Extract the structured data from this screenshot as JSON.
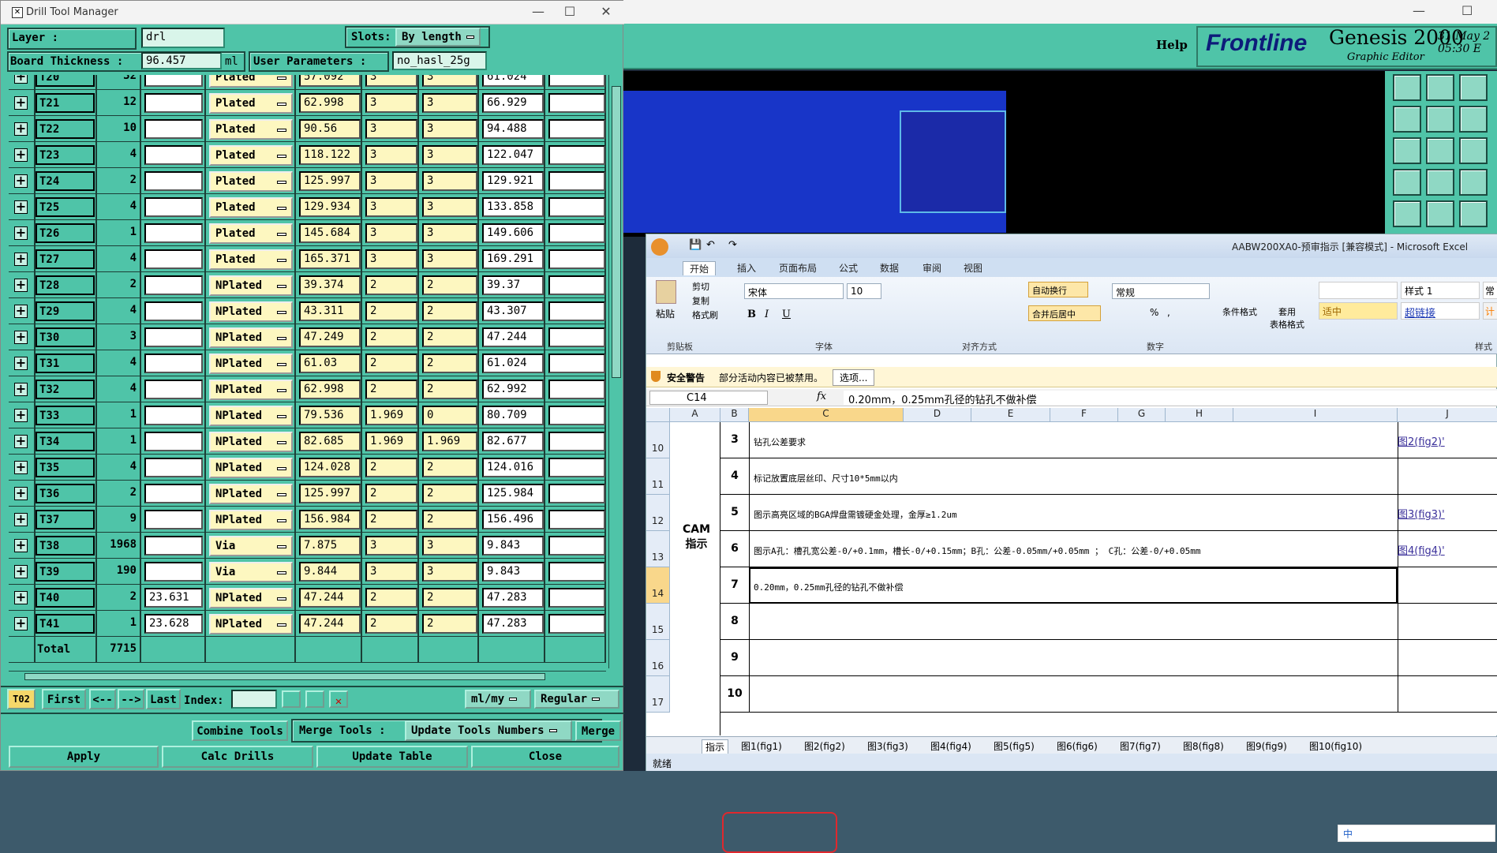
{
  "genesis": {
    "help_label": "Help",
    "logo_text": "Frontline",
    "product": "Genesis 2000",
    "subtitle": "Graphic Editor",
    "date": "31 May 2",
    "time": "05:30 E"
  },
  "dtm": {
    "title": "Drill Tool Manager",
    "layer_label": "Layer            :",
    "layer_value": "drl",
    "slots_label": "Slots:",
    "slots_value": "By length",
    "board_thickness_label": "Board Thickness :",
    "board_thickness_value": "96.457",
    "board_thickness_unit": "ml",
    "user_params_label": "User Parameters :",
    "user_params_value": "no_hasl_25g",
    "rows": [
      {
        "tool": "T20",
        "count": "32",
        "v1": "",
        "type": "Plated",
        "fin": "57.092",
        "tp": "3",
        "tm": "3",
        "drill": "61.024",
        "v2": ""
      },
      {
        "tool": "T21",
        "count": "12",
        "v1": "",
        "type": "Plated",
        "fin": "62.998",
        "tp": "3",
        "tm": "3",
        "drill": "66.929",
        "v2": ""
      },
      {
        "tool": "T22",
        "count": "10",
        "v1": "",
        "type": "Plated",
        "fin": "90.56",
        "tp": "3",
        "tm": "3",
        "drill": "94.488",
        "v2": ""
      },
      {
        "tool": "T23",
        "count": "4",
        "v1": "",
        "type": "Plated",
        "fin": "118.122",
        "tp": "3",
        "tm": "3",
        "drill": "122.047",
        "v2": ""
      },
      {
        "tool": "T24",
        "count": "2",
        "v1": "",
        "type": "Plated",
        "fin": "125.997",
        "tp": "3",
        "tm": "3",
        "drill": "129.921",
        "v2": ""
      },
      {
        "tool": "T25",
        "count": "4",
        "v1": "",
        "type": "Plated",
        "fin": "129.934",
        "tp": "3",
        "tm": "3",
        "drill": "133.858",
        "v2": ""
      },
      {
        "tool": "T26",
        "count": "1",
        "v1": "",
        "type": "Plated",
        "fin": "145.684",
        "tp": "3",
        "tm": "3",
        "drill": "149.606",
        "v2": ""
      },
      {
        "tool": "T27",
        "count": "4",
        "v1": "",
        "type": "Plated",
        "fin": "165.371",
        "tp": "3",
        "tm": "3",
        "drill": "169.291",
        "v2": ""
      },
      {
        "tool": "T28",
        "count": "2",
        "v1": "",
        "type": "NPlated",
        "fin": "39.374",
        "tp": "2",
        "tm": "2",
        "drill": "39.37",
        "v2": ""
      },
      {
        "tool": "T29",
        "count": "4",
        "v1": "",
        "type": "NPlated",
        "fin": "43.311",
        "tp": "2",
        "tm": "2",
        "drill": "43.307",
        "v2": ""
      },
      {
        "tool": "T30",
        "count": "3",
        "v1": "",
        "type": "NPlated",
        "fin": "47.249",
        "tp": "2",
        "tm": "2",
        "drill": "47.244",
        "v2": ""
      },
      {
        "tool": "T31",
        "count": "4",
        "v1": "",
        "type": "NPlated",
        "fin": "61.03",
        "tp": "2",
        "tm": "2",
        "drill": "61.024",
        "v2": ""
      },
      {
        "tool": "T32",
        "count": "4",
        "v1": "",
        "type": "NPlated",
        "fin": "62.998",
        "tp": "2",
        "tm": "2",
        "drill": "62.992",
        "v2": ""
      },
      {
        "tool": "T33",
        "count": "1",
        "v1": "",
        "type": "NPlated",
        "fin": "79.536",
        "tp": "1.969",
        "tm": "0",
        "drill": "80.709",
        "v2": ""
      },
      {
        "tool": "T34",
        "count": "1",
        "v1": "",
        "type": "NPlated",
        "fin": "82.685",
        "tp": "1.969",
        "tm": "1.969",
        "drill": "82.677",
        "v2": ""
      },
      {
        "tool": "T35",
        "count": "4",
        "v1": "",
        "type": "NPlated",
        "fin": "124.028",
        "tp": "2",
        "tm": "2",
        "drill": "124.016",
        "v2": ""
      },
      {
        "tool": "T36",
        "count": "2",
        "v1": "",
        "type": "NPlated",
        "fin": "125.997",
        "tp": "2",
        "tm": "2",
        "drill": "125.984",
        "v2": ""
      },
      {
        "tool": "T37",
        "count": "9",
        "v1": "",
        "type": "NPlated",
        "fin": "156.984",
        "tp": "2",
        "tm": "2",
        "drill": "156.496",
        "v2": ""
      },
      {
        "tool": "T38",
        "count": "1968",
        "v1": "",
        "type": "Via",
        "fin": "7.875",
        "tp": "3",
        "tm": "3",
        "drill": "9.843",
        "v2": ""
      },
      {
        "tool": "T39",
        "count": "190",
        "v1": "",
        "type": "Via",
        "fin": "9.844",
        "tp": "3",
        "tm": "3",
        "drill": "9.843",
        "v2": ""
      },
      {
        "tool": "T40",
        "count": "2",
        "v1": "23.631",
        "type": "NPlated",
        "fin": "47.244",
        "tp": "2",
        "tm": "2",
        "drill": "47.283",
        "v2": ""
      },
      {
        "tool": "T41",
        "count": "1",
        "v1": "23.628",
        "type": "NPlated",
        "fin": "47.244",
        "tp": "2",
        "tm": "2",
        "drill": "47.283",
        "v2": ""
      }
    ],
    "total_label": "Total",
    "total_value": "7715",
    "nav": {
      "current": "T02",
      "first": "First",
      "prev": "<--",
      "next": "-->",
      "last": "Last",
      "index_label": "Index:",
      "units": "ml/my",
      "mode": "Regular"
    },
    "combine_tools": "Combine Tools",
    "merge_tools_label": "Merge Tools :",
    "merge_tools_value": "Update Tools Numbers",
    "merge": "Merge",
    "apply": "Apply",
    "calc_drills": "Calc Drills",
    "update_table": "Update Table",
    "close": "Close"
  },
  "excel": {
    "title": "AABW200XA0-预审指示  [兼容模式] - Microsoft Excel",
    "tabs": [
      "开始",
      "插入",
      "页面布局",
      "公式",
      "数据",
      "审阅",
      "视图"
    ],
    "clipboard": {
      "paste": "粘贴",
      "cut": "剪切",
      "copy": "复制",
      "format_painter": "格式刷",
      "group": "剪贴板"
    },
    "font": {
      "name": "宋体",
      "size": "10",
      "bold": "B",
      "italic": "I",
      "underline": "U",
      "group": "字体"
    },
    "alignment": {
      "wrap": "自动换行",
      "merge": "合并后居中",
      "group": "对齐方式"
    },
    "number": {
      "format": "常规",
      "group": "数字",
      "percent": "%",
      "comma": ","
    },
    "styles": {
      "conditional": "条件格式",
      "table": "套用\n表格格式",
      "style1": "样式 1",
      "style_chang": "常",
      "moderate": "适中",
      "hyperlink": "超链接",
      "calc": "计",
      "group": "样式"
    },
    "security_label": "安全警告",
    "security_text": "部分活动内容已被禁用。",
    "options": "选项...",
    "name_box": "C14",
    "fx": "fx",
    "formula": "0.20mm，0.25mm孔径的钻孔不做补偿",
    "columns": [
      "A",
      "B",
      "C",
      "D",
      "E",
      "F",
      "G",
      "H",
      "I",
      "J"
    ],
    "cam_label": "CAM",
    "cam_label2": "指示",
    "rows": [
      {
        "row": "10",
        "num": "3",
        "text": "钻孔公差要求",
        "link": "图2(fig2)'"
      },
      {
        "row": "11",
        "num": "4",
        "text": "标记放置底层丝印、尺寸10*5mm以内",
        "link": ""
      },
      {
        "row": "12",
        "num": "5",
        "text": "图示高亮区域的BGA焊盘需镀硬金处理，金厚≥1.2um",
        "link": "图3(fig3)'"
      },
      {
        "row": "13",
        "num": "6",
        "text": "图示A孔：槽孔宽公差-0/+0.1mm，槽长-0/+0.15mm；B孔：公差-0.05mm/+0.05mm ； C孔：公差-0/+0.05mm",
        "link": "图4(fig4)'"
      },
      {
        "row": "14",
        "num": "7",
        "text": "0.20mm，0.25mm孔径的钻孔不做补偿",
        "link": ""
      },
      {
        "row": "15",
        "num": "8",
        "text": "",
        "link": ""
      },
      {
        "row": "16",
        "num": "9",
        "text": "",
        "link": ""
      },
      {
        "row": "17",
        "num": "10",
        "text": "",
        "link": ""
      }
    ],
    "sheets": [
      "指示",
      "图1(fig1)",
      "图2(fig2)",
      "图3(fig3)",
      "图4(fig4)",
      "图5(fig5)",
      "图6(fig6)",
      "图7(fig7)",
      "图8(fig8)",
      "图9(fig9)",
      "图10(fig10)"
    ],
    "status": "就绪",
    "ime": "中"
  }
}
